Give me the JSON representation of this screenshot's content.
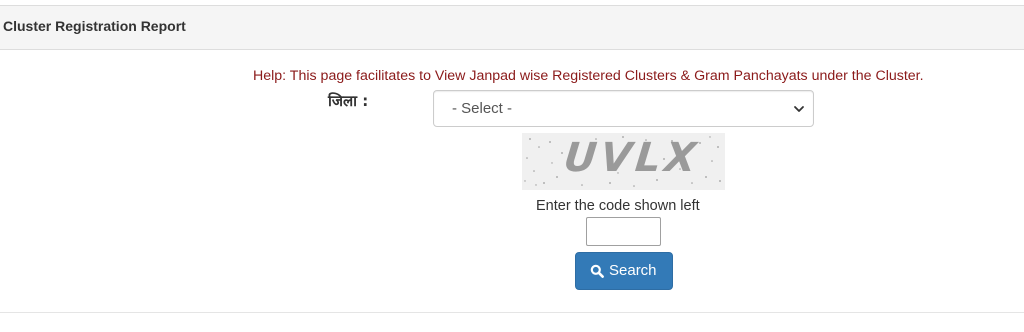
{
  "report": {
    "title": "Cluster Registration Report",
    "help_text": "Help: This page facilitates to View Janpad wise Registered Clusters & Gram Panchayats under the Cluster."
  },
  "form": {
    "district_label": "जिला :",
    "district_select": {
      "selected": "- Select -"
    },
    "captcha": {
      "code": "UVLX"
    },
    "code_prompt": "Enter the code shown left",
    "code_input": {
      "value": "",
      "placeholder": ""
    },
    "search_button": {
      "label": "Search",
      "icon": "search-icon"
    }
  },
  "colors": {
    "heading_bg": "#f5f5f5",
    "help_text": "#8b1a1a",
    "button_bg": "#337ab7"
  }
}
